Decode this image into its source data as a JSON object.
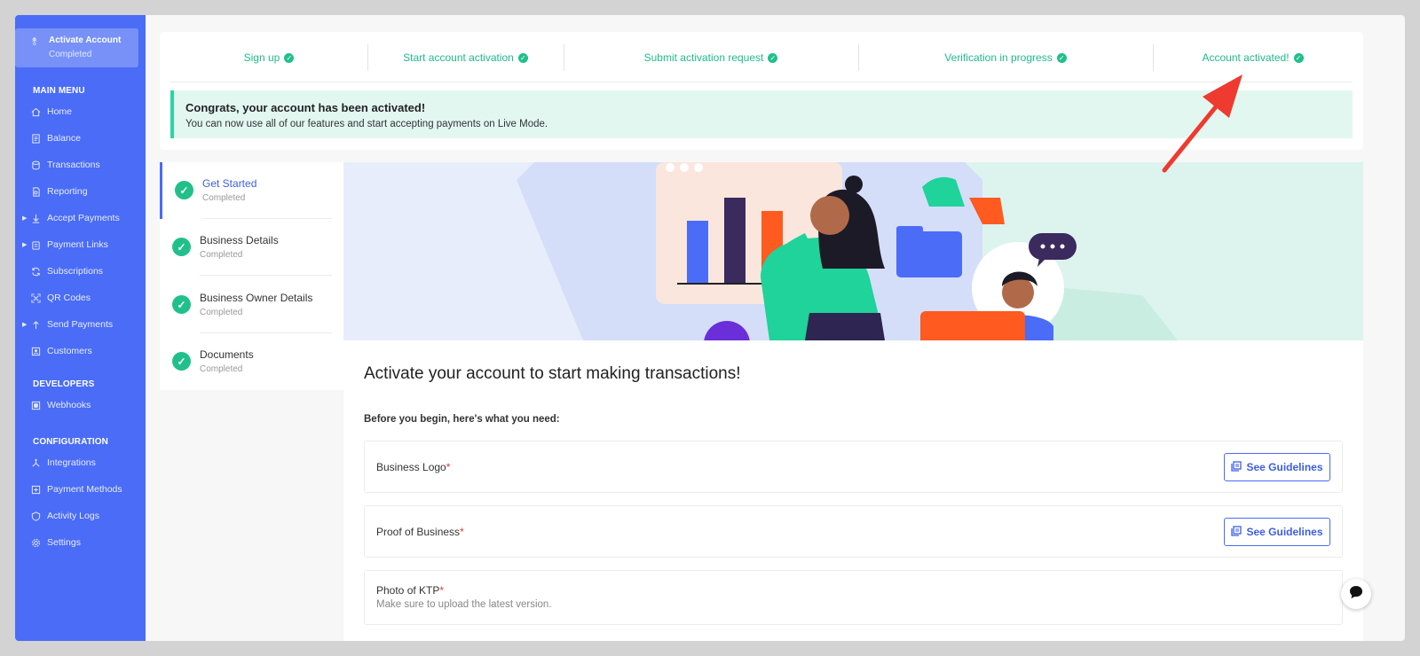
{
  "sidebar": {
    "activate": {
      "title": "Activate Account",
      "status": "Completed",
      "icon": "activate-icon"
    },
    "sections": {
      "main": "MAIN MENU",
      "developers": "DEVELOPERS",
      "configuration": "CONFIGURATION"
    },
    "main_items": [
      {
        "label": "Home",
        "icon": "home-icon",
        "expandable": false
      },
      {
        "label": "Balance",
        "icon": "balance-icon",
        "expandable": false
      },
      {
        "label": "Transactions",
        "icon": "transactions-icon",
        "expandable": false
      },
      {
        "label": "Reporting",
        "icon": "reporting-icon",
        "expandable": false
      },
      {
        "label": "Accept Payments",
        "icon": "accept-payments-icon",
        "expandable": true
      },
      {
        "label": "Payment Links",
        "icon": "payment-links-icon",
        "expandable": true
      },
      {
        "label": "Subscriptions",
        "icon": "subscriptions-icon",
        "expandable": false
      },
      {
        "label": "QR Codes",
        "icon": "qr-codes-icon",
        "expandable": false
      },
      {
        "label": "Send Payments",
        "icon": "send-payments-icon",
        "expandable": true
      },
      {
        "label": "Customers",
        "icon": "customers-icon",
        "expandable": false
      }
    ],
    "developer_items": [
      {
        "label": "Webhooks",
        "icon": "webhooks-icon"
      }
    ],
    "config_items": [
      {
        "label": "Integrations",
        "icon": "integrations-icon"
      },
      {
        "label": "Payment Methods",
        "icon": "payment-methods-icon"
      },
      {
        "label": "Activity Logs",
        "icon": "activity-logs-icon"
      },
      {
        "label": "Settings",
        "icon": "settings-icon"
      }
    ]
  },
  "progress_steps": [
    "Sign up",
    "Start account activation",
    "Submit activation request",
    "Verification in progress",
    "Account activated!"
  ],
  "banner": {
    "title": "Congrats, your account has been activated!",
    "text": "You can now use all of our features and start accepting payments on Live Mode."
  },
  "side_steps": [
    {
      "title": "Get Started",
      "status": "Completed"
    },
    {
      "title": "Business Details",
      "status": "Completed"
    },
    {
      "title": "Business Owner Details",
      "status": "Completed"
    },
    {
      "title": "Documents",
      "status": "Completed"
    }
  ],
  "main": {
    "heading": "Activate your account to start making transactions!",
    "need_label": "Before you begin, here's what you need:",
    "requirements": [
      {
        "label": "Business Logo",
        "required_mark": "*",
        "button": "See Guidelines",
        "sub": ""
      },
      {
        "label": "Proof of Business",
        "required_mark": "*",
        "button": "See Guidelines",
        "sub": ""
      },
      {
        "label": "Photo of KTP",
        "required_mark": "*",
        "button": "",
        "sub": "Make sure to upload the latest version."
      }
    ]
  },
  "colors": {
    "sidebar": "#4a6cf7",
    "success": "#21c08b",
    "accent": "#3d5ee6",
    "annotation_arrow": "#ee3a2f"
  },
  "icons": {
    "check": "check-icon",
    "guidelines": "guidelines-icon",
    "chat": "chat-bubble-icon",
    "arrow": "annotation-arrow"
  }
}
